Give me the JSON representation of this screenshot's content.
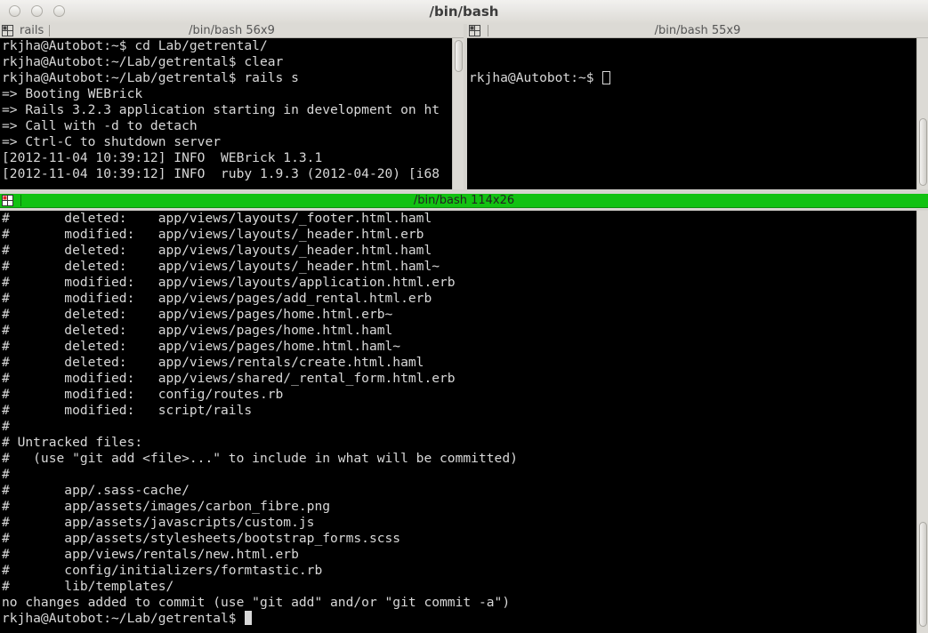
{
  "window": {
    "title": "/bin/bash",
    "buttons": [
      "close-button",
      "minimize-button",
      "maximize-button"
    ]
  },
  "panes": {
    "top_left": {
      "tab_name": "rails",
      "title": "/bin/bash 56x9",
      "icon": "terminal-split-icon",
      "lines": [
        "rkjha@Autobot:~$ cd Lab/getrental/",
        "rkjha@Autobot:~/Lab/getrental$ clear",
        "rkjha@Autobot:~/Lab/getrental$ rails s",
        "=> Booting WEBrick",
        "=> Rails 3.2.3 application starting in development on ht",
        "=> Call with -d to detach",
        "=> Ctrl-C to shutdown server",
        "[2012-11-04 10:39:12] INFO  WEBrick 1.3.1",
        "[2012-11-04 10:39:12] INFO  ruby 1.9.3 (2012-04-20) [i68"
      ]
    },
    "top_right": {
      "title": "/bin/bash 55x9",
      "icon": "terminal-split-icon",
      "prompt": "rkjha@Autobot:~$ "
    },
    "bottom": {
      "title": "/bin/bash 114x26",
      "icon": "terminal-split-icon",
      "active_color": "#12c212",
      "lines": [
        "#       deleted:    app/views/layouts/_footer.html.haml",
        "#       modified:   app/views/layouts/_header.html.erb",
        "#       deleted:    app/views/layouts/_header.html.haml",
        "#       deleted:    app/views/layouts/_header.html.haml~",
        "#       modified:   app/views/layouts/application.html.erb",
        "#       modified:   app/views/pages/add_rental.html.erb",
        "#       deleted:    app/views/pages/home.html.erb~",
        "#       deleted:    app/views/pages/home.html.haml",
        "#       deleted:    app/views/pages/home.html.haml~",
        "#       deleted:    app/views/rentals/create.html.haml",
        "#       modified:   app/views/shared/_rental_form.html.erb",
        "#       modified:   config/routes.rb",
        "#       modified:   script/rails",
        "#",
        "# Untracked files:",
        "#   (use \"git add <file>...\" to include in what will be committed)",
        "#",
        "#       app/.sass-cache/",
        "#       app/assets/images/carbon_fibre.png",
        "#       app/assets/javascripts/custom.js",
        "#       app/assets/stylesheets/bootstrap_forms.scss",
        "#       app/views/rentals/new.html.erb",
        "#       config/initializers/formtastic.rb",
        "#       lib/templates/",
        "no changes added to commit (use \"git add\" and/or \"git commit -a\")"
      ],
      "prompt": "rkjha@Autobot:~/Lab/getrental$ "
    }
  }
}
